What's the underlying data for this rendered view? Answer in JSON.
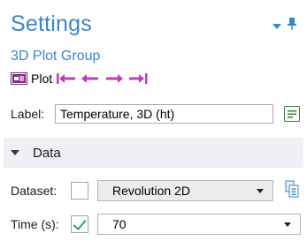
{
  "header": {
    "title": "Settings",
    "subtitle": "3D Plot Group"
  },
  "toolbar": {
    "plot_label": "Plot",
    "nav_icons": [
      "first-icon",
      "previous-icon",
      "next-icon",
      "last-icon"
    ],
    "accent_color": "#c23bb8"
  },
  "label_field": {
    "label": "Label:",
    "value": "Temperature, 3D (ht)"
  },
  "section": {
    "title": "Data"
  },
  "dataset": {
    "label": "Dataset:",
    "checked": false,
    "selected": "Revolution 2D"
  },
  "time": {
    "label": "Time (s):",
    "checked": true,
    "selected": "70"
  },
  "colors": {
    "title": "#3a86cc",
    "section_bg": "#eff0f5"
  }
}
